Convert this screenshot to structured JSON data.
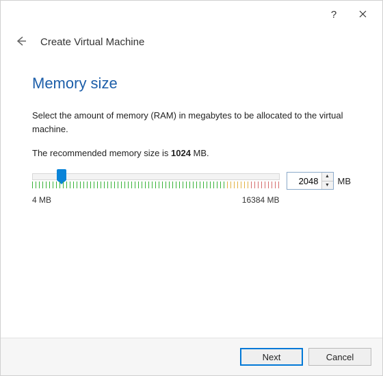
{
  "titlebar": {
    "help_icon": "?",
    "close_icon": "✕"
  },
  "dialog": {
    "title": "Create Virtual Machine"
  },
  "section": {
    "heading": "Memory size",
    "description": "Select the amount of memory (RAM) in megabytes to be allocated to the virtual machine.",
    "recommended_prefix": "The recommended memory size is ",
    "recommended_value": "1024",
    "recommended_suffix": " MB."
  },
  "slider": {
    "min_label": "4 MB",
    "max_label": "16384 MB",
    "value": "2048",
    "unit": "MB"
  },
  "buttons": {
    "next": "Next",
    "cancel": "Cancel"
  }
}
